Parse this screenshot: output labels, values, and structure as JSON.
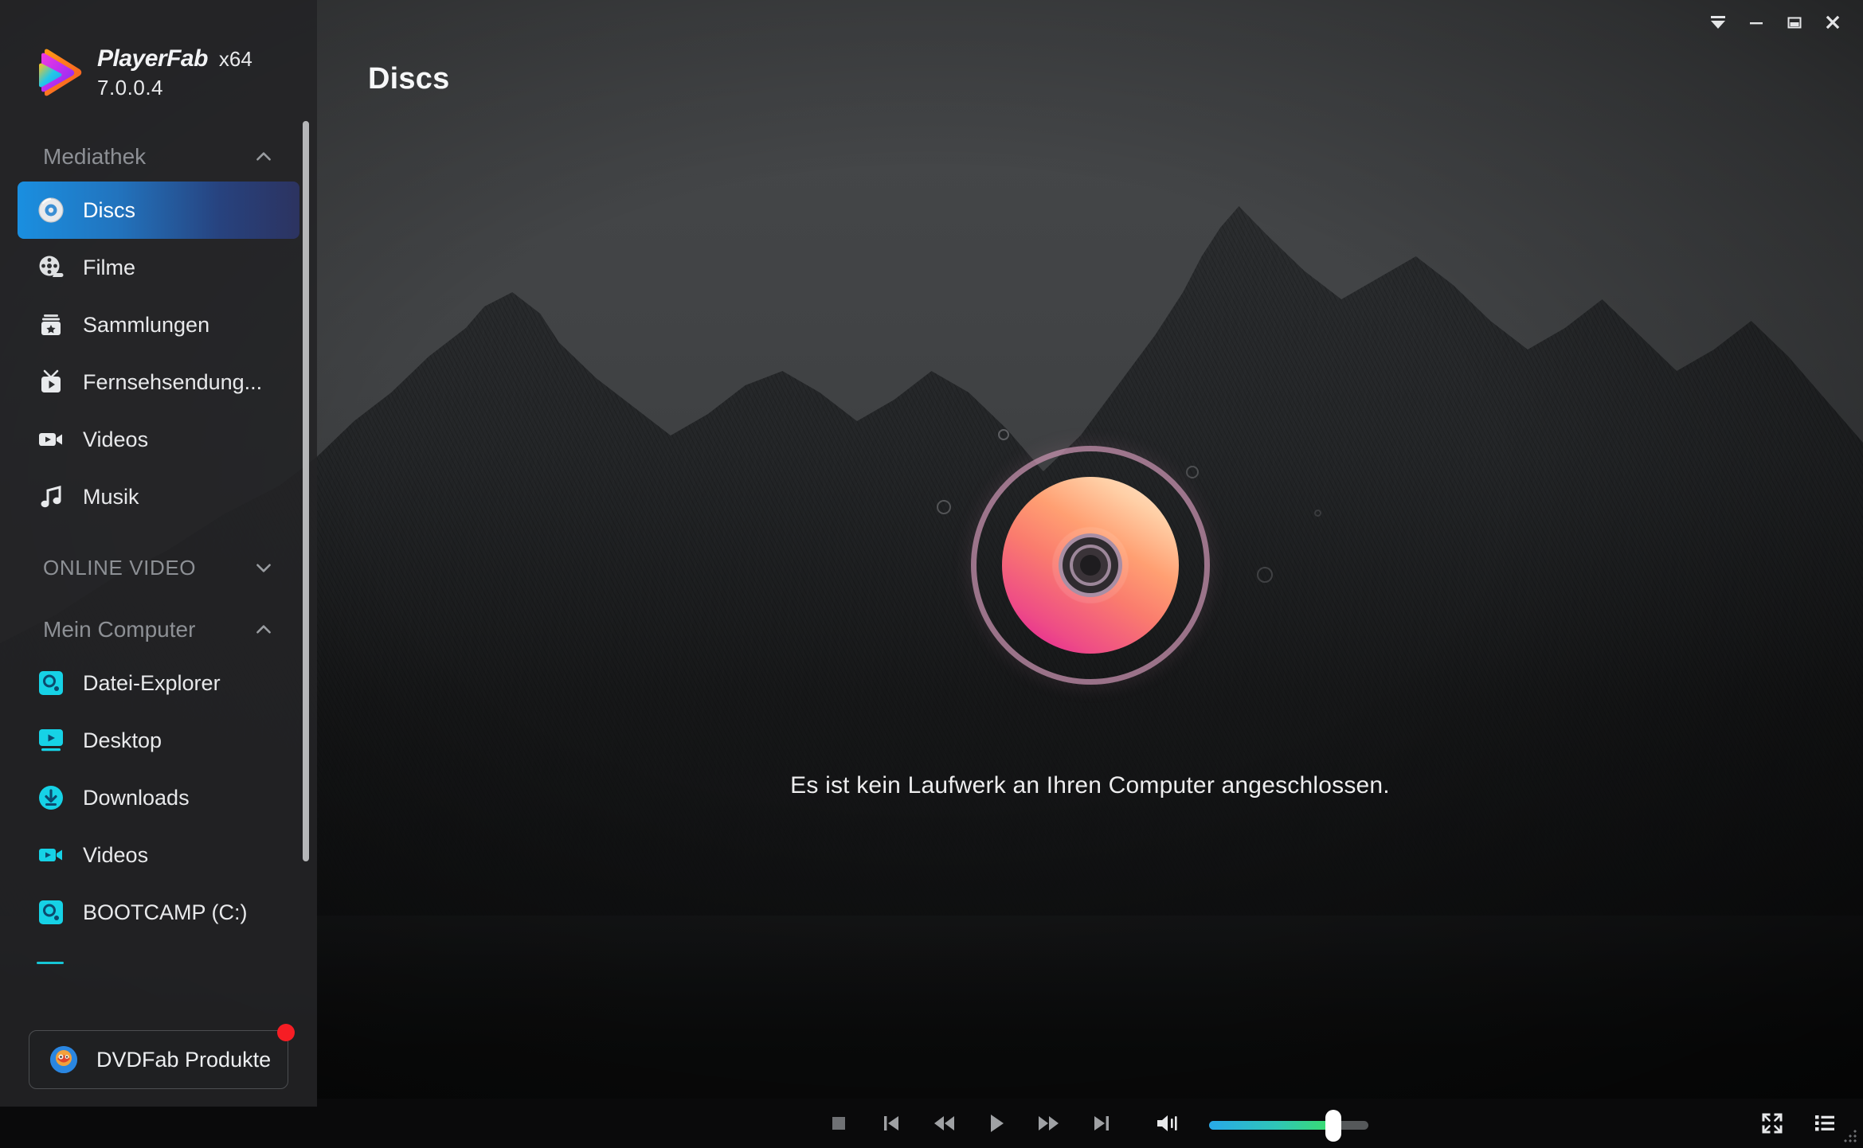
{
  "app": {
    "brand_name": "PlayerFab",
    "architecture": "x64",
    "version": "7.0.0.4",
    "logo_icon": "playerfab-play-logo-icon"
  },
  "titlebar": {
    "buttons": [
      {
        "name": "collapse-menu-button",
        "icon": "bar-triangle-down-icon",
        "label": ""
      },
      {
        "name": "minimize-button",
        "icon": "minimize-icon",
        "label": ""
      },
      {
        "name": "maximize-button",
        "icon": "maximize-restore-icon",
        "label": ""
      },
      {
        "name": "close-button",
        "icon": "close-x-icon",
        "label": ""
      }
    ]
  },
  "sidebar": {
    "groups": [
      {
        "label": "Mediathek",
        "chevron": "chevron-up-icon",
        "expanded": true,
        "items": [
          {
            "label": "Discs",
            "icon": "disc-icon",
            "active": true
          },
          {
            "label": "Filme",
            "icon": "film-reel-icon",
            "active": false
          },
          {
            "label": "Sammlungen",
            "icon": "collection-box-icon",
            "active": false
          },
          {
            "label": "Fernsehsendung...",
            "icon": "tv-show-icon",
            "active": false
          },
          {
            "label": "Videos",
            "icon": "video-camera-icon",
            "active": false
          },
          {
            "label": "Musik",
            "icon": "music-note-icon",
            "active": false
          }
        ]
      },
      {
        "label": "ONLINE VIDEO",
        "chevron": "chevron-down-icon",
        "expanded": false,
        "items": []
      },
      {
        "label": "Mein Computer",
        "chevron": "chevron-up-icon",
        "expanded": true,
        "items": [
          {
            "label": "Datei-Explorer",
            "icon": "file-explorer-icon",
            "active": false
          },
          {
            "label": "Desktop",
            "icon": "desktop-icon",
            "active": false
          },
          {
            "label": "Downloads",
            "icon": "downloads-icon",
            "active": false
          },
          {
            "label": "Videos",
            "icon": "video-camera-icon",
            "active": false
          },
          {
            "label": "BOOTCAMP (C:)",
            "icon": "drive-icon",
            "active": false
          }
        ]
      }
    ],
    "promo": {
      "label": "DVDFab Produkte",
      "icon": "dvdfab-logo-icon",
      "badge": true,
      "badge_color": "#f61d24"
    },
    "scrollbar_visible": true
  },
  "main": {
    "page_title": "Discs",
    "notice": "Es ist kein Laufwerk an Ihren Computer angeschlossen.",
    "disc_graphic": "disc-illustration-icon"
  },
  "player": {
    "controls": [
      {
        "name": "stop-button",
        "icon": "stop-icon"
      },
      {
        "name": "previous-button",
        "icon": "skip-previous-icon"
      },
      {
        "name": "rewind-button",
        "icon": "rewind-icon"
      },
      {
        "name": "play-button",
        "icon": "play-icon"
      },
      {
        "name": "fast-forward-button",
        "icon": "fast-forward-icon"
      },
      {
        "name": "next-button",
        "icon": "skip-next-icon"
      }
    ],
    "volume": {
      "icon": "volume-on-icon",
      "value": 78,
      "min": 0,
      "max": 100
    },
    "right_controls": [
      {
        "name": "fullscreen-button",
        "icon": "fullscreen-expand-icon"
      },
      {
        "name": "playlist-button",
        "icon": "playlist-list-icon"
      }
    ]
  },
  "colors": {
    "accent_blue": "#1a8fe0",
    "accent_cyan": "#16c6d6",
    "badge_red": "#f61d24",
    "volume_start": "#28a9e8",
    "volume_end": "#3ade6b",
    "sidebar_bg": "#232426",
    "playerbar_bg": "#0a0a0b"
  }
}
